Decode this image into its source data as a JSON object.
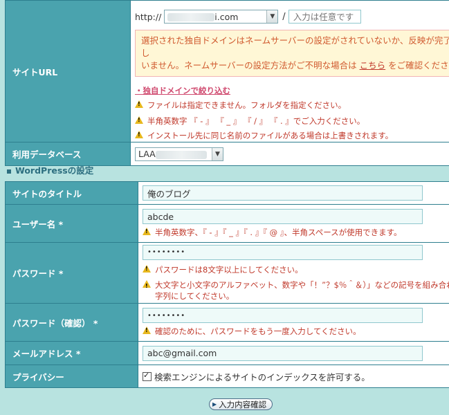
{
  "site_url": {
    "label": "サイトURL",
    "prefix": "http://",
    "domain_suffix": "i.com",
    "slash": "/",
    "path_placeholder": "入力は任意です",
    "notice_part1": "選択された独自ドメインはネームサーバーの設定がされていないか、反映が完了し",
    "notice_part2": "いません。ネームサーバーの設定方法がご不明な場合は ",
    "notice_link": "こちら",
    "notice_part3": " をご確認くださ",
    "narrow_link": "・独自ドメインで絞り込む",
    "warnings": [
      "ファイルは指定できません。フォルダを指定ください。",
      "半角英数字 『 - 』 『 _ 』 『 / 』 『 . 』でご入力ください。",
      "インストール先に同じ名前のファイルがある場合は上書きされます。"
    ]
  },
  "database": {
    "label": "利用データベース",
    "value_prefix": "LAA"
  },
  "wp_settings": {
    "section_title": "WordPressの設定",
    "site_title_label": "サイトのタイトル",
    "site_title_value": "俺のブログ",
    "username_label": "ユーザー名 *",
    "username_value": "abcde",
    "username_warning": "半角英数字、『 - 』『 _ 』『 . 』『 @ 』、半角スペースが使用できます。",
    "password_label": "パスワード *",
    "password_value": "••••••••",
    "password_warning1": "パスワードは8文字以上にしてください。",
    "password_warning2_l1": "大文字と小文字のアルファベット、数字や「！”？$％＾＆）」などの記号を組み合わ",
    "password_warning2_l2": "字列にしてください。",
    "password_confirm_label": "パスワード（確認） *",
    "password_confirm_value": "••••••••",
    "password_confirm_warning": "確認のために、パスワードをもう一度入力してください。",
    "email_label": "メールアドレス *",
    "email_value": "abc@gmail.com",
    "privacy_label": "プライバシー",
    "privacy_checkbox_label": "検索エンジンによるサイトのインデックスを許可する。"
  },
  "submit_label": "入力内容確認"
}
